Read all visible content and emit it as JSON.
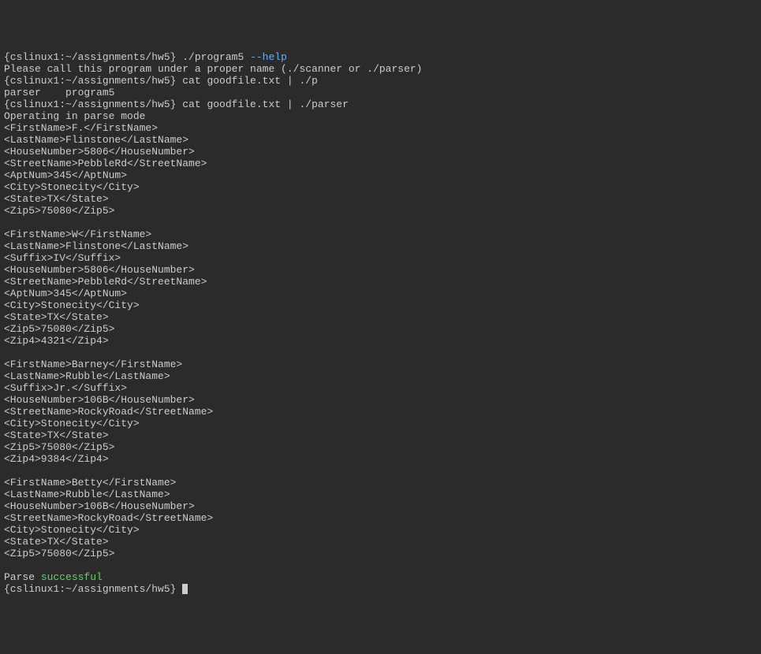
{
  "lines": {
    "l1_prompt": "{cslinux1:~/assignments/hw5} ./program5 ",
    "l1_flag": "--help",
    "l2": "Please call this program under a proper name (./scanner or ./parser)",
    "l3": "{cslinux1:~/assignments/hw5} cat goodfile.txt | ./p",
    "l4": "parser    program5",
    "l5": "{cslinux1:~/assignments/hw5} cat goodfile.txt | ./parser",
    "l6": "Operating in parse mode",
    "l7": "<FirstName>F.</FirstName>",
    "l8": "<LastName>Flinstone</LastName>",
    "l9": "<HouseNumber>5806</HouseNumber>",
    "l10": "<StreetName>PebbleRd</StreetName>",
    "l11": "<AptNum>345</AptNum>",
    "l12": "<City>Stonecity</City>",
    "l13": "<State>TX</State>",
    "l14": "<Zip5>75080</Zip5>",
    "l15": "",
    "l16": "<FirstName>W</FirstName>",
    "l17": "<LastName>Flinstone</LastName>",
    "l18": "<Suffix>IV</Suffix>",
    "l19": "<HouseNumber>5806</HouseNumber>",
    "l20": "<StreetName>PebbleRd</StreetName>",
    "l21": "<AptNum>345</AptNum>",
    "l22": "<City>Stonecity</City>",
    "l23": "<State>TX</State>",
    "l24": "<Zip5>75080</Zip5>",
    "l25": "<Zip4>4321</Zip4>",
    "l26": "",
    "l27": "<FirstName>Barney</FirstName>",
    "l28": "<LastName>Rubble</LastName>",
    "l29": "<Suffix>Jr.</Suffix>",
    "l30": "<HouseNumber>106B</HouseNumber>",
    "l31": "<StreetName>RockyRoad</StreetName>",
    "l32": "<City>Stonecity</City>",
    "l33": "<State>TX</State>",
    "l34": "<Zip5>75080</Zip5>",
    "l35": "<Zip4>9384</Zip4>",
    "l36": "",
    "l37": "<FirstName>Betty</FirstName>",
    "l38": "<LastName>Rubble</LastName>",
    "l39": "<HouseNumber>106B</HouseNumber>",
    "l40": "<StreetName>RockyRoad</StreetName>",
    "l41": "<City>Stonecity</City>",
    "l42": "<State>TX</State>",
    "l43": "<Zip5>75080</Zip5>",
    "l44": "",
    "l45_parse": "Parse ",
    "l45_success": "successful",
    "l46_prompt": "{cslinux1:~/assignments/hw5} "
  }
}
